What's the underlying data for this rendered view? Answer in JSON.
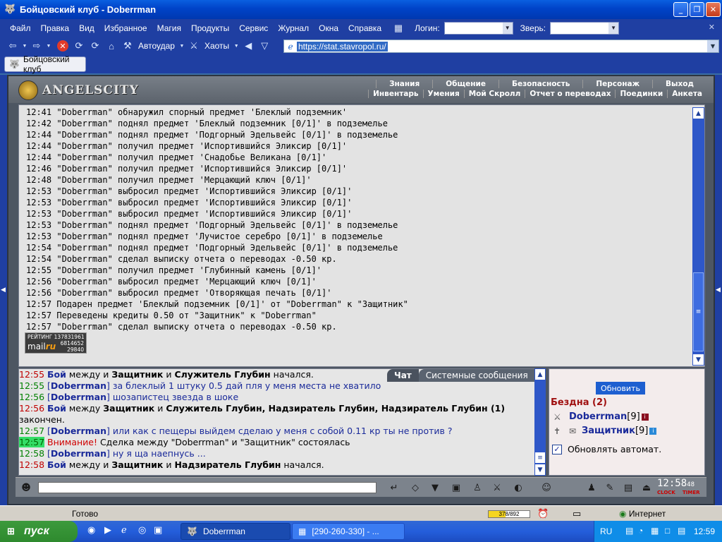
{
  "window": {
    "title": "Бойцовский клуб - Doberrman",
    "buttons": [
      "_",
      "❐",
      "✕"
    ]
  },
  "menu": {
    "items": [
      "Файл",
      "Правка",
      "Вид",
      "Избранное",
      "Магия",
      "Продукты",
      "Сервис",
      "Журнал",
      "Окна",
      "Справка"
    ],
    "login_label": "Логин:",
    "pet_label": "Зверь:"
  },
  "toolbar": {
    "autoudar_label": "Автоудар",
    "haoty_label": "Хаоты",
    "address": "https://stat.stavropol.ru/"
  },
  "tab": {
    "label": "Бойцовский клуб"
  },
  "game": {
    "logo": "ANGELSCITY",
    "nav_top": [
      "Знания",
      "Общение",
      "Безопасность",
      "Персонаж",
      "Выход"
    ],
    "nav_bottom": [
      "Инвентарь",
      "Умения",
      "Мой Скролл",
      "Отчет о переводах",
      "Поединки",
      "Анкета"
    ],
    "log_lines": [
      "12:41 \"Doberrman\" обнаружил спорный предмет 'Блеклый подземник'",
      "12:42 \"Doberrman\" поднял предмет 'Блеклый подземник [0/1]' в подземелье",
      "12:44 \"Doberrman\" поднял предмет 'Подгорный Эдельвейс [0/1]' в подземелье",
      "12:44 \"Doberrman\" получил предмет 'Испортившийся Эликсир [0/1]'",
      "12:44 \"Doberrman\" получил предмет 'Снадобье Великана [0/1]'",
      "12:46 \"Doberrman\" получил предмет 'Испортившийся Эликсир [0/1]'",
      "12:48 \"Doberrman\" получил предмет 'Мерцающий ключ [0/1]'",
      "12:53 \"Doberrman\" выбросил предмет 'Испортившийся Эликсир [0/1]'",
      "12:53 \"Doberrman\" выбросил предмет 'Испортившийся Эликсир [0/1]'",
      "12:53 \"Doberrman\" выбросил предмет 'Испортившийся Эликсир [0/1]'",
      "12:53 \"Doberrman\" поднял предмет 'Подгорный Эдельвейс [0/1]' в подземелье",
      "12:53 \"Doberrman\" поднял предмет 'Лучистое серебро [0/1]' в подземелье",
      "12:54 \"Doberrman\" поднял предмет 'Подгорный Эдельвейс [0/1]' в подземелье",
      "12:54 \"Doberrman\" сделал выписку отчета о переводах -0.50 кр.",
      "12:55 \"Doberrman\" получил предмет 'Глубинный камень [0/1]'",
      "12:56 \"Doberrman\" выбросил предмет 'Мерцающий ключ [0/1]'",
      "12:56 \"Doberrman\" выбросил предмет 'Отворяющая печать [0/1]'",
      "12:57 Подарен предмет 'Блеклый подземник [0/1]' от \"Doberrman\" к \"Защитник\"",
      "12:57 Переведены кредиты 0.50 от \"Защитник\" к \"Doberrman\"",
      "12:57 \"Doberrman\" сделал выписку отчета о переводах -0.50 кр."
    ],
    "counter": {
      "rating": "РЕЙТИНГ 137831961",
      "brand_a": "mail",
      "brand_b": "ru",
      "num1": "6814652",
      "num2": "29840"
    }
  },
  "chat": {
    "tabs": [
      "Чат",
      "Системные сообщения"
    ],
    "lines": [
      {
        "time": "12:55",
        "tstyle": "t",
        "parts": [
          [
            "boi",
            "Бой"
          ],
          [
            "txt",
            " между и "
          ],
          [
            "b",
            "Защитник"
          ],
          [
            "txt",
            " и "
          ],
          [
            "b",
            "Служитель Глубин"
          ],
          [
            "txt",
            " начался."
          ]
        ]
      },
      {
        "time": "12:55",
        "tstyle": "t gr",
        "parts": [
          [
            "blu",
            "["
          ],
          [
            "nick",
            "Doberrman"
          ],
          [
            "blu",
            "] за блеклый 1 штуку 0.5 дай пля у меня места не хватило"
          ]
        ]
      },
      {
        "time": "12:56",
        "tstyle": "t gr",
        "parts": [
          [
            "blu",
            "["
          ],
          [
            "nick",
            "Doberrman"
          ],
          [
            "blu",
            "] шозапистец звезда в шоке"
          ]
        ]
      },
      {
        "time": "12:56",
        "tstyle": "t",
        "parts": [
          [
            "boi",
            "Бой"
          ],
          [
            "txt",
            " между "
          ],
          [
            "b",
            "Защитник"
          ],
          [
            "txt",
            " и "
          ],
          [
            "b",
            "Служитель Глубин, Надзиратель Глубин, Надзиратель Глубин (1)"
          ]
        ]
      },
      {
        "time": "",
        "tstyle": "t",
        "parts": [
          [
            "txt",
            "закончен."
          ]
        ]
      },
      {
        "time": "12:57",
        "tstyle": "t gr",
        "parts": [
          [
            "blu",
            "["
          ],
          [
            "nick",
            "Doberrman"
          ],
          [
            "blu",
            "] или как с пещеры выйдем сделаю у меня с собой 0.11 кр ты не против ?"
          ]
        ]
      },
      {
        "time": "12:57",
        "tstyle": "t hl",
        "parts": [
          [
            "warn",
            "Внимание!"
          ],
          [
            "txt",
            " Сделка между \"Doberrman\" и \"Защитник\" состоялась"
          ]
        ]
      },
      {
        "time": "12:58",
        "tstyle": "t gr",
        "parts": [
          [
            "blu",
            "["
          ],
          [
            "nick",
            "Doberrman"
          ],
          [
            "blu",
            "] ну я ща наепнусь ..."
          ]
        ]
      },
      {
        "time": "12:58",
        "tstyle": "t",
        "parts": [
          [
            "boi",
            "Бой"
          ],
          [
            "txt",
            " между и "
          ],
          [
            "b",
            "Защитник"
          ],
          [
            "txt",
            " и "
          ],
          [
            "b",
            "Надзиратель Глубин"
          ],
          [
            "txt",
            " начался."
          ]
        ]
      }
    ]
  },
  "side": {
    "refresh": "Обновить",
    "location": "Бездна (2)",
    "players": [
      {
        "name": "Doberrman",
        "level": "[9]",
        "info": "i",
        "info_color": "#8a1020"
      },
      {
        "name": "Защитник",
        "level": "[9]",
        "info": "i",
        "info_color": "#2a8ad8"
      }
    ],
    "auto_label": "Обновлять автомат."
  },
  "clock": {
    "time": "12:58",
    "sec": "48",
    "label1": "CLOCK",
    "label2": "TIMER"
  },
  "status": {
    "ready": "Готово",
    "progress_text": "378/892",
    "progress_fraction": 0.42,
    "zone": "Интернет"
  },
  "taskbar": {
    "start": "пуск",
    "buttons": [
      "Doberrman",
      "[290-260-330] - ..."
    ],
    "lang": "RU",
    "time": "12:59"
  }
}
